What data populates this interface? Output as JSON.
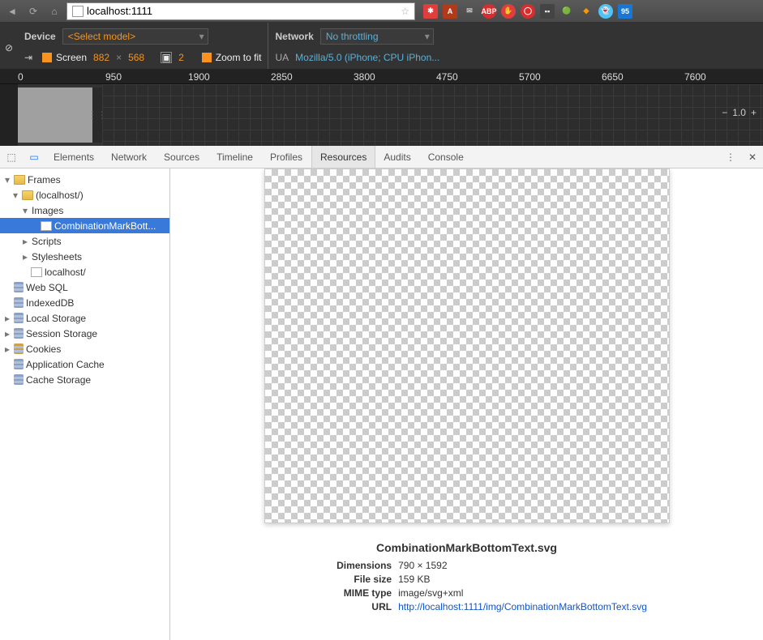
{
  "url": "localhost:1111",
  "device": {
    "label": "Device",
    "model": "<Select model>",
    "screen_label": "Screen",
    "width": "882",
    "x": "×",
    "height": "568",
    "dpr": "2",
    "zoom_label": "Zoom to fit"
  },
  "network": {
    "label": "Network",
    "throttling": "No throttling",
    "ua_label": "UA",
    "ua_value": "Mozilla/5.0 (iPhone; CPU iPhon..."
  },
  "ruler": {
    "t0": "0",
    "t1": "950",
    "t2": "1900",
    "t3": "2850",
    "t4": "3800",
    "t5": "4750",
    "t6": "5700",
    "t7": "6650",
    "t8": "7600"
  },
  "zoom": {
    "level": "1.0"
  },
  "tabs": {
    "elements": "Elements",
    "network": "Network",
    "sources": "Sources",
    "timeline": "Timeline",
    "profiles": "Profiles",
    "resources": "Resources",
    "audits": "Audits",
    "console": "Console"
  },
  "tree": {
    "frames": "Frames",
    "localhost": "(localhost/)",
    "images": "Images",
    "selected_file": "CombinationMarkBott...",
    "scripts": "Scripts",
    "stylesheets": "Stylesheets",
    "localhost_doc": "localhost/",
    "websql": "Web SQL",
    "indexeddb": "IndexedDB",
    "localstorage": "Local Storage",
    "sessionstorage": "Session Storage",
    "cookies": "Cookies",
    "appcache": "Application Cache",
    "cachestorage": "Cache Storage"
  },
  "preview": {
    "filename": "CombinationMarkBottomText.svg",
    "dimensions_k": "Dimensions",
    "dimensions_v": "790 × 1592",
    "filesize_k": "File size",
    "filesize_v": "159 KB",
    "mime_k": "MIME type",
    "mime_v": "image/svg+xml",
    "url_k": "URL",
    "url_v": "http://localhost:1111/img/CombinationMarkBottomText.svg"
  }
}
